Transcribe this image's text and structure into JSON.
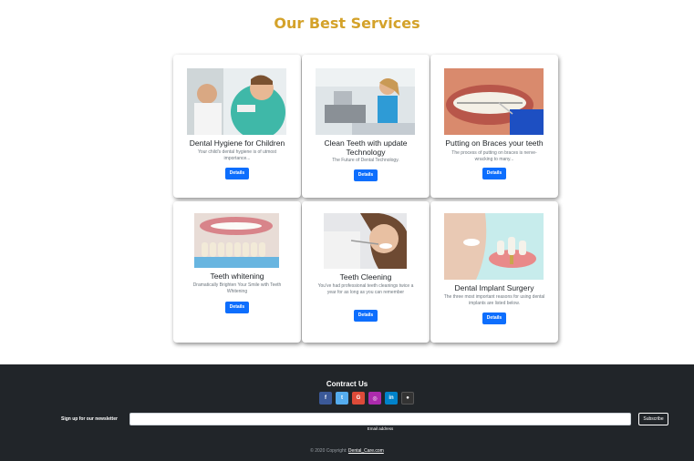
{
  "page": {
    "section_title": "Our Best Services"
  },
  "services": [
    {
      "title": "Dental Hygiene for Children",
      "text": "Your child's dental hygiene is of utmost importance...",
      "button": "Details"
    },
    {
      "title": "Clean Teeth with update Technology",
      "text": "The Future of Dental Technology.",
      "button": "Details"
    },
    {
      "title": "Putting on Braces your teeth",
      "text": "The process of putting on braces is nerve-wracking to many...",
      "button": "Details"
    },
    {
      "title": "Teeth whitening",
      "text": "Dramatically Brighten Your Smile with Teeth Whitening",
      "button": "Details"
    },
    {
      "title": "Teeth Cleening",
      "text": "You've had professional teeth cleanings twice a year for as long as you can remember",
      "button": "Details"
    },
    {
      "title": "Dental Implant Surgery",
      "text": "The three most important reasons for using dental implants are listed below.",
      "button": "Details"
    }
  ],
  "footer": {
    "title": "Contract Us",
    "social": [
      {
        "icon": "facebook-icon",
        "glyph": "f",
        "color": "#3b5998"
      },
      {
        "icon": "twitter-icon",
        "glyph": "t",
        "color": "#55acee"
      },
      {
        "icon": "google-icon",
        "glyph": "G",
        "color": "#dd4b39"
      },
      {
        "icon": "instagram-icon",
        "glyph": "◎",
        "color": "#ac2bac"
      },
      {
        "icon": "linkedin-icon",
        "glyph": "in",
        "color": "#0082ca"
      },
      {
        "icon": "github-icon",
        "glyph": "●",
        "color": "#333333"
      }
    ],
    "newsletter_label": "Sign up for our newsletter",
    "email_value": "",
    "email_hint": "Email address",
    "subscribe_label": "Subscribe",
    "copyright_prefix": "© 2020 Copyright:",
    "copyright_link": "Dental_Care.com"
  }
}
